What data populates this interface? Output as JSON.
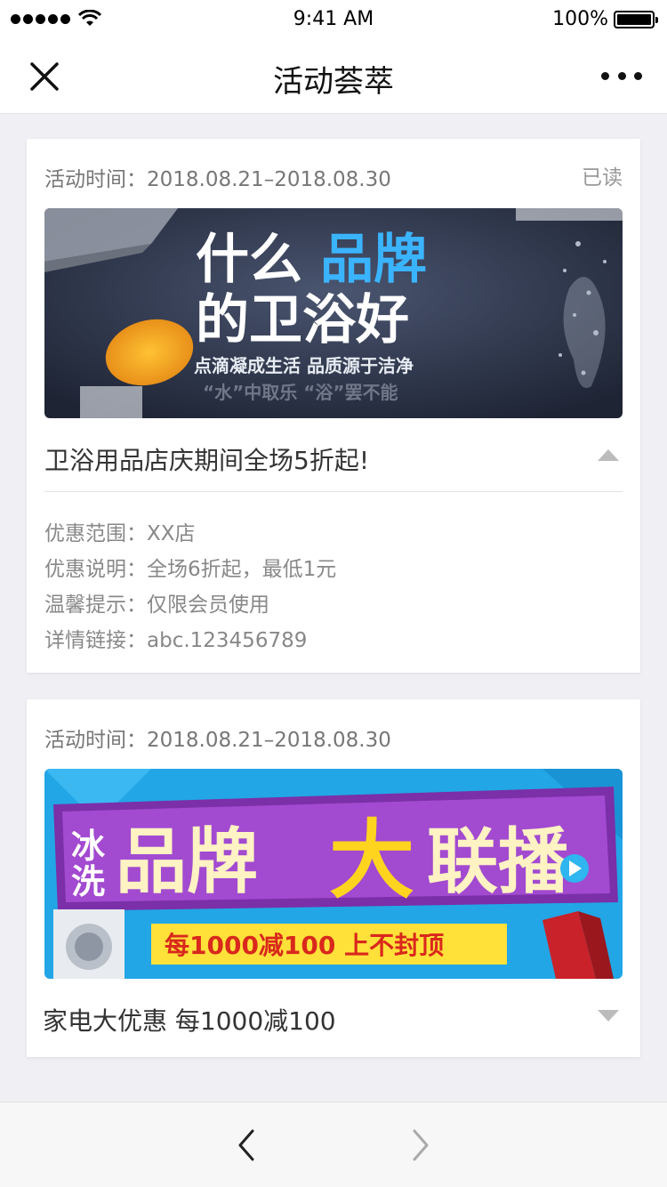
{
  "status_bar": {
    "time": "9:41 AM",
    "battery": "100%"
  },
  "nav": {
    "title": "活动荟萃"
  },
  "cards": [
    {
      "time": "活动时间：2018.08.21–2018.08.30",
      "read_badge": "已读",
      "banner": {
        "line1a": "什么",
        "line1b": "品牌",
        "line2": "的卫浴好",
        "sub": "点滴凝成生活  品质源于洁净",
        "sub2": "“水”中取乐  “浴”罢不能"
      },
      "title": "卫浴用品店庆期间全场5折起!",
      "details": [
        "优惠范围：XX店",
        "优惠说明：全场6折起，最低1元",
        "温馨提示：仅限会员使用",
        "详情链接：abc.123456789"
      ]
    },
    {
      "time": "活动时间：2018.08.21–2018.08.30",
      "banner": {
        "left1": "冰",
        "left2": "洗",
        "main1": "品牌",
        "main2": "大",
        "main3": "联播",
        "ribbon": "每1000减100 上不封顶"
      },
      "title": "家电大优惠 每1000减100"
    }
  ],
  "colors": {
    "accent_blue": "#1fa3e8",
    "banner1_bg": "#2b3348",
    "banner2_bg": "#22a6e6"
  }
}
